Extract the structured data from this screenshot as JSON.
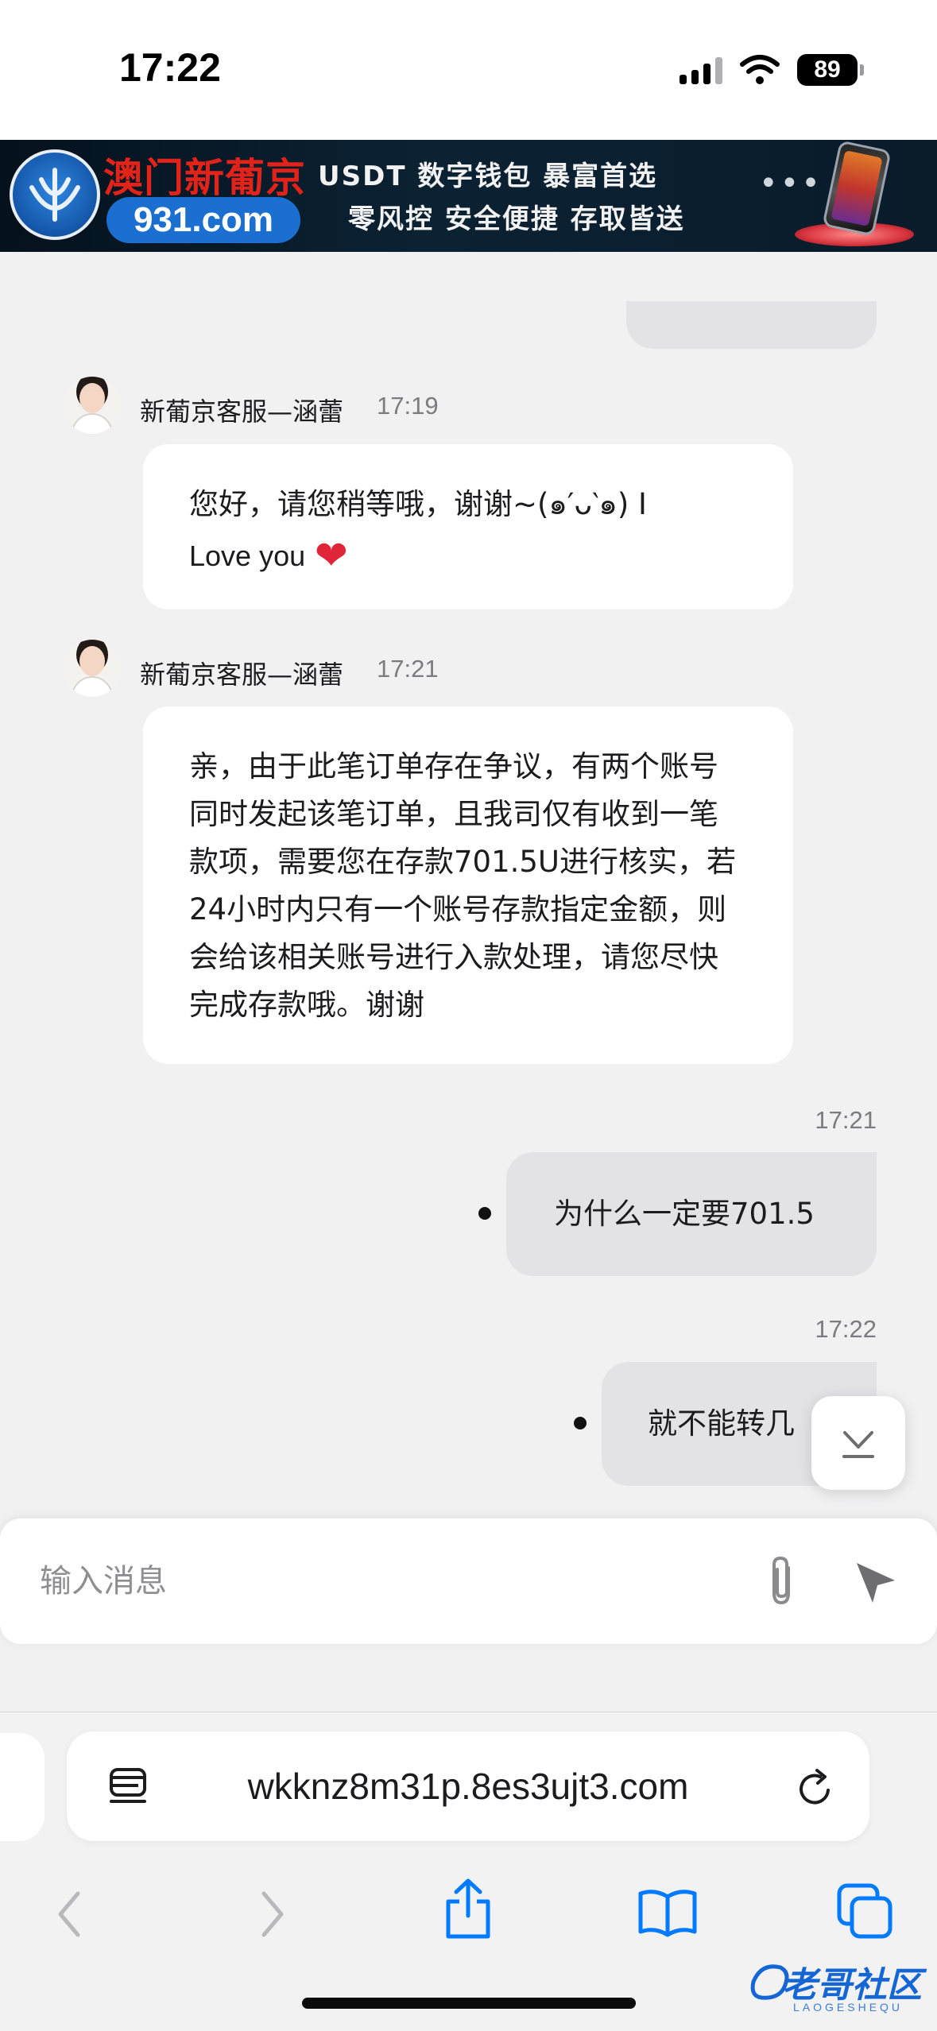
{
  "status_bar": {
    "time": "17:22",
    "battery": "89"
  },
  "ad": {
    "brand": "澳门新葡京",
    "domain": "931.com",
    "line1": "USDT  数字钱包  暴富首选",
    "line2": "零风控  安全便捷  存取皆送",
    "more": "•••"
  },
  "chat": {
    "messages_in": [
      {
        "sender": "新葡京客服—涵蕾",
        "time": "17:19",
        "text": "您好，请您稍等哦，谢谢~(๑′ᴗ‵๑) I",
        "love": "Love you",
        "heart": "❤"
      },
      {
        "sender": "新葡京客服—涵蕾",
        "time": "17:21",
        "text": "亲，由于此笔订单存在争议，有两个账号同时发起该笔订单，且我司仅有收到一笔款项，需要您在存款701.5U进行核实，若24小时内只有一个账号存款指定金额，则会给该相关账号进行入款处理，请您尽快完成存款哦。谢谢"
      }
    ],
    "messages_out": [
      {
        "time": "17:21",
        "text": "为什么一定要701.5"
      },
      {
        "time": "17:22",
        "text": "就不能转几"
      }
    ]
  },
  "composer": {
    "placeholder": "输入消息"
  },
  "safari": {
    "url": "wkknz8m31p.8es3ujt3.com"
  },
  "watermark": {
    "text": "老哥社区",
    "sub": "LAOGESHEQU"
  },
  "colors": {
    "accent": "#007aff",
    "chat_background": "#f1f1f2",
    "incoming_bubble": "#ffffff",
    "outgoing_bubble": "#e3e3e5",
    "heart": "#e02539",
    "ad_brand_red": "#e2231a"
  },
  "icons": {
    "signal": "cellular-signal-icon",
    "wifi": "wifi-icon",
    "attach": "paperclip-icon",
    "send": "send-arrow-icon",
    "scroll": "scroll-to-bottom-icon",
    "reader": "reader-mode-icon",
    "reload": "reload-icon",
    "back": "chevron-left-icon",
    "forward": "chevron-right-icon",
    "share": "share-icon",
    "bookmarks": "book-icon",
    "tabs": "tabs-icon"
  }
}
